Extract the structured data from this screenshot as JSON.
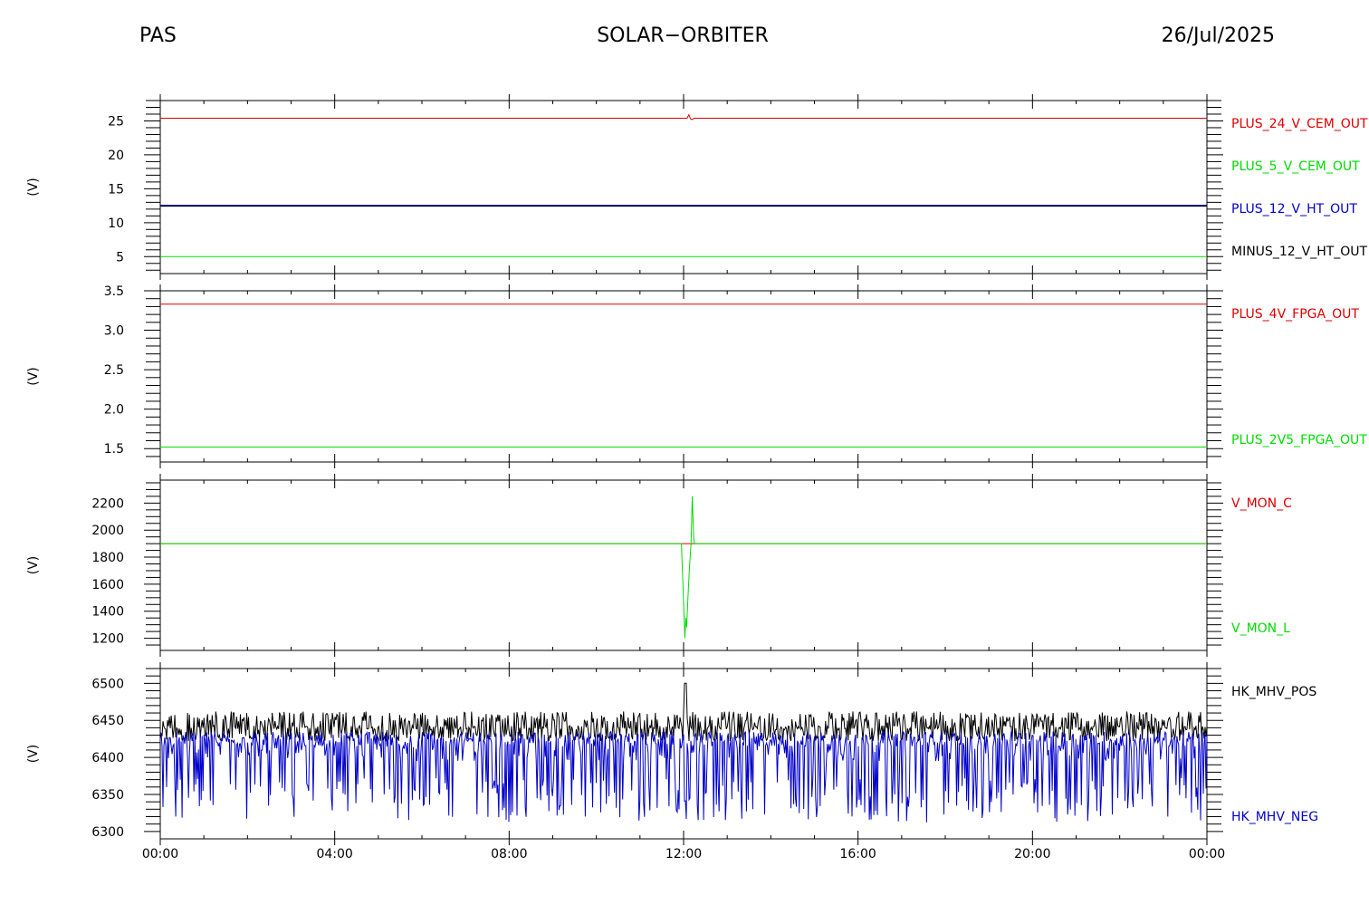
{
  "header": {
    "instrument": "PAS",
    "mission": "SOLAR−ORBITER",
    "date": "26/Jul/2025"
  },
  "chart_data": [
    {
      "type": "line",
      "ylabel": "(V)",
      "ylim": [
        2.5,
        28.0
      ],
      "yticks": [
        5,
        10,
        15,
        20,
        25
      ],
      "ytick_labels": [
        "5",
        "10",
        "15",
        "20",
        "25"
      ],
      "minor_step": 1,
      "legend": "right",
      "series": [
        {
          "name": "PLUS_24_V_CEM_OUT",
          "color": "#dd0000",
          "constant": 25.4,
          "glitch": {
            "hour": 12.08,
            "values": [
              25.4,
              25.9,
              25.3,
              25.2,
              25.4
            ]
          }
        },
        {
          "name": "PLUS_5_V_CEM_OUT",
          "color": "#00dd00",
          "constant": 5.0
        },
        {
          "name": "PLUS_12_V_HT_OUT",
          "color": "#0000cc",
          "constant": 12.5,
          "width": 2
        },
        {
          "name": "MINUS_12_V_HT_OUT",
          "color": "#000000",
          "constant": 12.5
        }
      ]
    },
    {
      "type": "line",
      "ylabel": "(V)",
      "ylim": [
        1.33,
        3.5
      ],
      "yticks": [
        1.5,
        2.0,
        2.5,
        3.0,
        3.5
      ],
      "ytick_labels": [
        "1.5",
        "2.0",
        "2.5",
        "3.0",
        "3.5"
      ],
      "minor_step": 0.1,
      "legend": "right",
      "series": [
        {
          "name": "PLUS_4V_FPGA_OUT",
          "color": "#dd0000",
          "constant": 3.33
        },
        {
          "name": "PLUS_2V5_FPGA_OUT",
          "color": "#00dd00",
          "constant": 1.52
        }
      ]
    },
    {
      "type": "line",
      "ylabel": "(V)",
      "ylim": [
        1110,
        2370
      ],
      "yticks": [
        1200,
        1400,
        1600,
        1800,
        2000,
        2200
      ],
      "ytick_labels": [
        "1200",
        "1400",
        "1600",
        "1800",
        "2000",
        "2200"
      ],
      "minor_step": 50,
      "legend": "right",
      "series": [
        {
          "name": "V_MON_C",
          "color": "#dd0000",
          "constant": 1900
        },
        {
          "name": "V_MON_L",
          "color": "#00dd00",
          "constant": 1900,
          "spike": {
            "x": [
              11.95,
              12.03,
              12.05,
              12.07,
              12.1,
              12.13,
              12.17,
              12.2,
              12.23,
              12.25
            ],
            "y": [
              1900,
              1200,
              1350,
              1280,
              1500,
              1700,
              1900,
              2250,
              1950,
              1900
            ]
          }
        }
      ]
    },
    {
      "type": "line",
      "ylabel": "(V)",
      "ylim": [
        6290,
        6520
      ],
      "yticks": [
        6300,
        6350,
        6400,
        6450,
        6500
      ],
      "ytick_labels": [
        "6300",
        "6350",
        "6400",
        "6450",
        "6500"
      ],
      "minor_step": 10,
      "legend": "right",
      "series": [
        {
          "name": "HK_MHV_POS",
          "color": "#000000",
          "base": 6440,
          "low": 6422,
          "high": 6462,
          "spike": 6500
        },
        {
          "name": "HK_MHV_NEG",
          "color": "#0000cc",
          "base": 6415,
          "low": 6312,
          "high": 6440
        }
      ]
    }
  ],
  "xaxis": {
    "xlim": [
      0,
      24
    ],
    "major_hours": [
      0,
      4,
      8,
      12,
      16,
      20,
      24
    ],
    "tick_labels": [
      "00:00",
      "04:00",
      "08:00",
      "12:00",
      "16:00",
      "20:00",
      "00:00"
    ],
    "minor_step_hours": 1
  }
}
